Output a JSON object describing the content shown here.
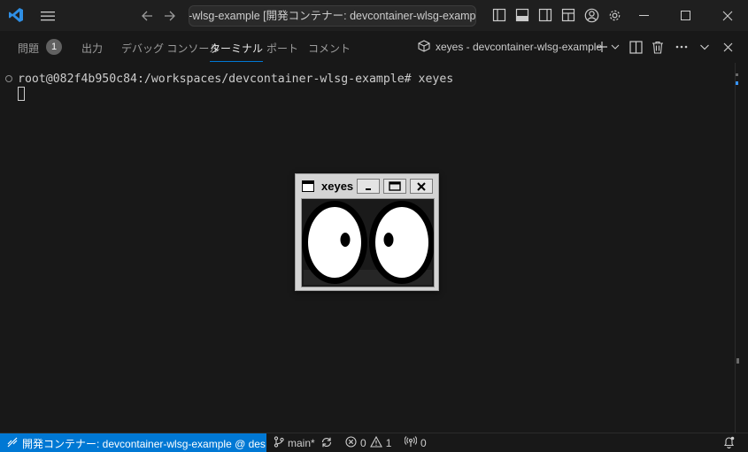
{
  "titlebar": {
    "command_center_text": "er-wlsg-example [開発コンテナー: devcontainer-wlsg-example @",
    "icons": [
      "vscode-logo",
      "menu-icon",
      "arrow-left-icon",
      "arrow-right-icon",
      "sidebar-left-icon",
      "panel-toggle-icon",
      "sidebar-right-icon",
      "layout-icon",
      "account-icon",
      "gear-icon",
      "minimize-icon",
      "maximize-icon",
      "close-icon"
    ]
  },
  "panel": {
    "tabs": [
      {
        "label": "問題",
        "active": false
      },
      {
        "label": "出力",
        "active": false
      },
      {
        "label": "デバッグ コンソール",
        "active": false
      },
      {
        "label": "ターミナル",
        "active": true
      },
      {
        "label": "ポート",
        "active": false
      },
      {
        "label": "コメント",
        "active": false
      }
    ],
    "problems_count": "1",
    "terminal_title": "xeyes - devcontainer-wlsg-example"
  },
  "terminal": {
    "line1": "root@082f4b950c84:/workspaces/devcontainer-wlsg-example# xeyes"
  },
  "xeyes_window": {
    "title": "xeyes",
    "buttons": [
      "minimize",
      "maximize",
      "close"
    ]
  },
  "statusbar": {
    "remote_label": "開発コンテナー: devcontainer-wlsg-example @ des...",
    "branch": "main*",
    "errors": "0",
    "warnings": "1",
    "ports": "0"
  },
  "colors": {
    "accent": "#0078d4",
    "background": "#181818",
    "titlebar": "#1f1f1f"
  }
}
